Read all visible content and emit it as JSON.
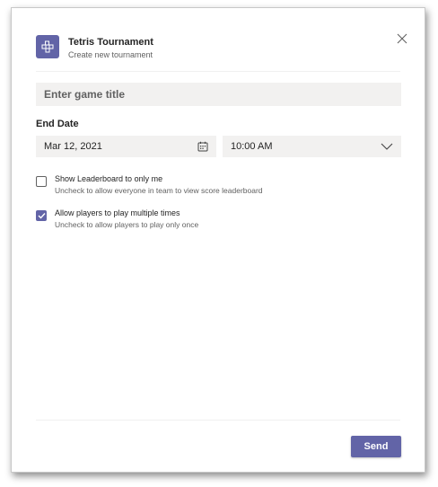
{
  "header": {
    "title": "Tetris Tournament",
    "subtitle": "Create new tournament"
  },
  "form": {
    "game_title_placeholder": "Enter game title",
    "game_title_value": "",
    "end_date_label": "End Date",
    "date_value": "Mar 12, 2021",
    "time_value": "10:00 AM"
  },
  "options": [
    {
      "title": "Show Leaderboard to only me",
      "description": "Uncheck to allow everyone in team to view score leaderboard",
      "checked": false
    },
    {
      "title": "Allow players to play multiple times",
      "description": "Uncheck to allow players to play only once",
      "checked": true
    }
  ],
  "footer": {
    "send_label": "Send"
  },
  "colors": {
    "accent": "#6264a7",
    "field_bg": "#f2f1f0",
    "text_primary": "#242424",
    "text_secondary": "#616161"
  },
  "icons": {
    "app": "tetris-grid-icon",
    "close": "close-icon",
    "calendar": "calendar-icon",
    "chevron": "chevron-down-icon",
    "check": "checkmark-icon"
  }
}
